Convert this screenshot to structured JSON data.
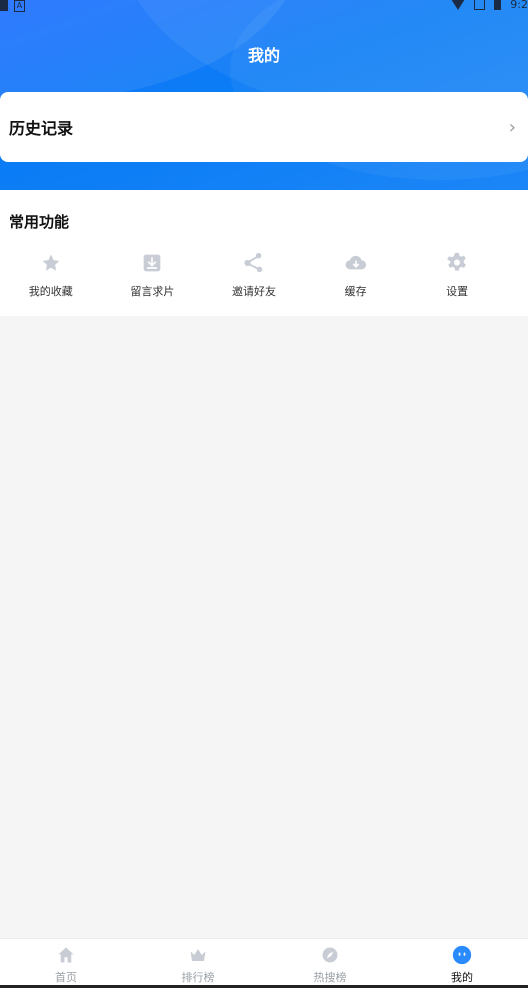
{
  "status_bar": {
    "time": "9:2"
  },
  "header": {
    "title": "我的"
  },
  "history": {
    "label": "历史记录",
    "chevron": "›"
  },
  "common": {
    "title": "常用功能",
    "items": [
      {
        "label": "我的收藏",
        "icon": "star-icon"
      },
      {
        "label": "留言求片",
        "icon": "download-box-icon"
      },
      {
        "label": "邀请好友",
        "icon": "share-icon"
      },
      {
        "label": "缓存",
        "icon": "cloud-download-icon"
      },
      {
        "label": "设置",
        "icon": "gear-icon"
      }
    ]
  },
  "tabbar": {
    "items": [
      {
        "label": "首页",
        "icon": "home-icon",
        "active": false
      },
      {
        "label": "排行榜",
        "icon": "crown-icon",
        "active": false
      },
      {
        "label": "热搜榜",
        "icon": "compass-icon",
        "active": false
      },
      {
        "label": "我的",
        "icon": "face-icon",
        "active": true
      }
    ]
  },
  "colors": {
    "accent": "#1a73f5",
    "icon_gray": "#c8ccd4",
    "active_blue": "#2a8bff"
  }
}
